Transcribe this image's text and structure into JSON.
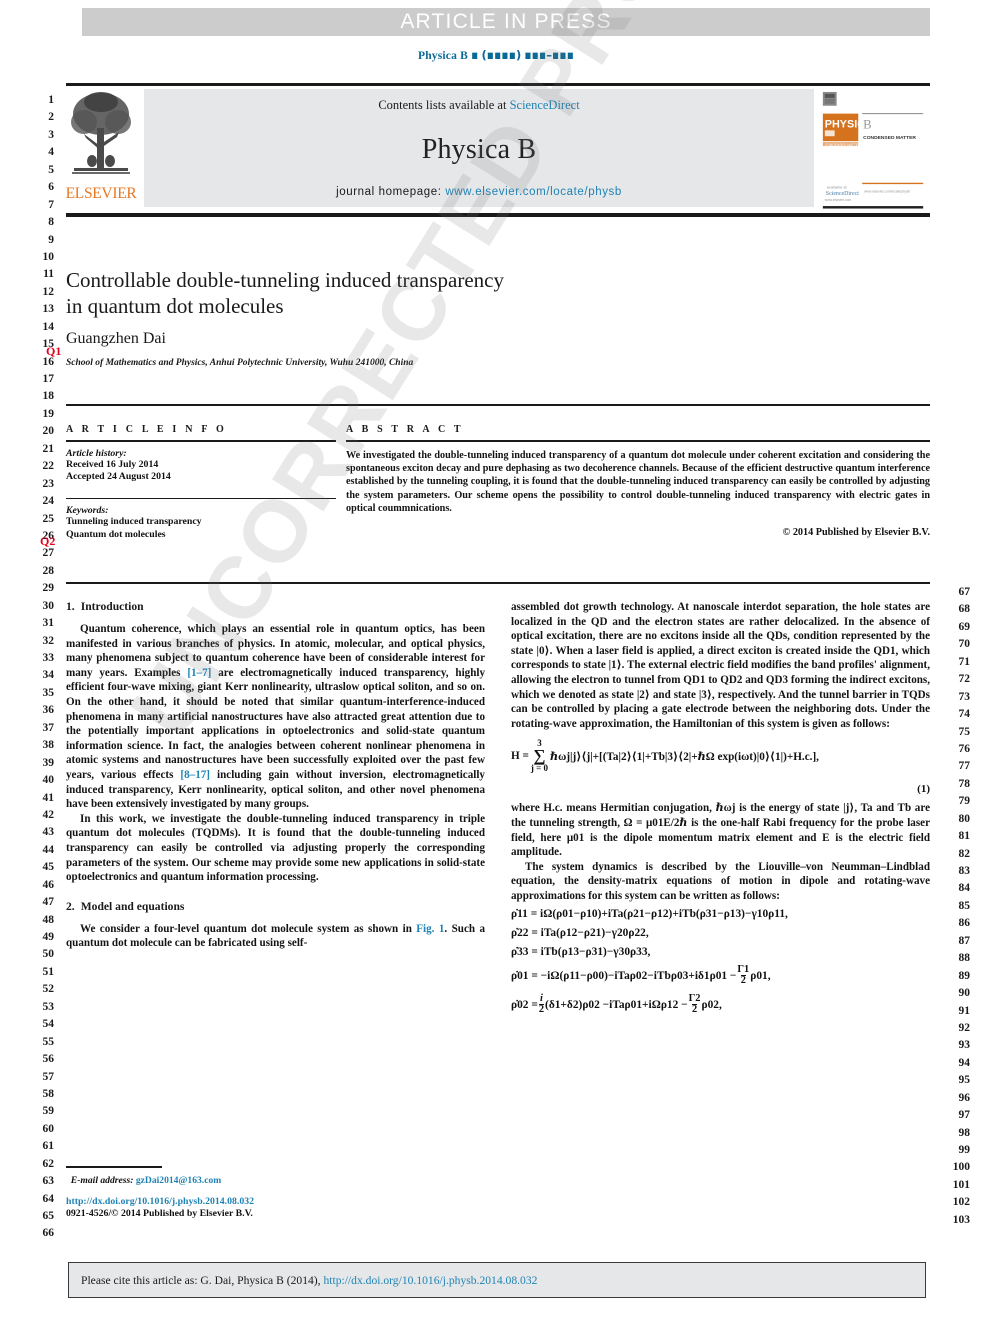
{
  "header": {
    "article_in_press": "ARTICLE IN PRESS",
    "running_ref_prefix": "Physica B",
    "running_ref_block1": "∎",
    "running_ref_paren": "(∎∎∎∎)",
    "running_ref_pages": "∎∎∎–∎∎∎"
  },
  "masthead": {
    "contents_text": "Contents lists available at",
    "sciencedirect": "ScienceDirect",
    "journal_title": "Physica B",
    "homepage_label": "journal homepage:",
    "homepage_url": "www.elsevier.com/locate/physb",
    "publisher": "ELSEVIER",
    "cover_journal": "PHYSICA",
    "cover_letter": "B",
    "cover_sub": "CONDENSED MATTER"
  },
  "title_block": {
    "title_line1": "Controllable double-tunneling induced transparency",
    "title_line2": "in quantum dot molecules",
    "author": "Guangzhen Dai",
    "affiliation": "School of Mathematics and Physics, Anhui Polytechnic University, Wuhu 241000, China",
    "query_1": "Q1",
    "query_2": "Q2"
  },
  "article_info": {
    "heading": "A R T I C L E  I N F O",
    "history_label": "Article history:",
    "received": "Received 16 July 2014",
    "accepted": "Accepted 24 August 2014",
    "keywords_label": "Keywords:",
    "keywords": [
      "Tunneling induced transparency",
      "Quantum dot molecules"
    ]
  },
  "abstract": {
    "heading": "A B S T R A C T",
    "text": "We investigated the double-tunneling induced transparency of a quantum dot molecule under coherent excitation and considering the spontaneous exciton decay and pure dephasing as two decoherence channels. Because of the efficient destructive quantum interference established by the tunneling coupling, it is found that the double-tunneling induced transparency can easily be controlled by adjusting the system parameters. Our scheme opens the possibility to control double-tunneling induced transparency with electric gates in optical coummnications.",
    "copyright": "© 2014 Published by Elsevier B.V."
  },
  "sections": {
    "s1_num": "1.",
    "s1_title": "Introduction",
    "s1_p1": "Quantum coherence, which plays an essential role in quantum optics, has been manifested in various branches of physics. In atomic, molecular, and optical physics, many phenomena subject to quantum coherence have been of considerable interest for many years. Examples [1–7] are electromagnetically induced transparency, highly efficient four-wave mixing, giant Kerr nonlinearity, ultraslow optical soliton, and so on. On the other hand, it should be noted that similar quantum-interference-induced phenomena in many artificial nanostructures have also attracted great attention due to the potentially important applications in optoelectronics and solid-state quantum information science. In fact, the analogies between coherent nonlinear phenomena in atomic systems and nanostructures have been successfully exploited over the past few years, various effects [8–17] including gain without inversion, electromagnetically induced transparency, Kerr nonlinearity, optical soliton, and other novel phenomena have been extensively investigated by many groups.",
    "s1_p1_cite1": "[1–7]",
    "s1_p1_cite2": "[8–17]",
    "s1_p2": "In this work, we investigate the double-tunneling induced transparency in triple quantum dot molecules (TQDMs). It is found that the double-tunneling induced transparency can easily be controlled via adjusting properly the corresponding parameters of the system. Our scheme may provide some new applications in solid-state optoelectronics and quantum information processing.",
    "s2_num": "2.",
    "s2_title": "Model and equations",
    "s2_p1": "We consider a four-level quantum dot molecule system as shown in Fig. 1. Such a quantum dot molecule can be fabricated using self-",
    "s2_p1_fig": "Fig. 1",
    "right_p1": "assembled dot growth technology. At nanoscale interdot separation, the hole states are localized in the QD and the electron states are rather delocalized. In the absence of optical excitation, there are no excitons inside all the QDs, condition represented by the state |0⟩. When a laser field is applied, a direct exciton is created inside the QD1, which corresponds to state |1⟩. The external electric field modifies the band profiles' alignment, allowing the electron to tunnel from QD1 to QD2 and QD3 forming the indirect excitons, which we denoted as state |2⟩ and state |3⟩, respectively. And the tunnel barrier in TQDs can be controlled by placing a gate electrode between the neighboring dots. Under the rotating-wave approximation, the Hamiltonian of this system is given as follows:",
    "right_p2": "where H.c. means Hermitian conjugation, ℏωj is the energy of state |j⟩, Ta and Tb are the tunneling strength, Ω = μ01E/2ℏ is the one-half Rabi frequency for the probe laser field, here μ01 is the dipole momentum matrix element and E is the electric field amplitude.",
    "right_p3": "The system dynamics is described by the Liouville–von Neumman–Lindblad equation, the density-matrix equations of motion in dipole and rotating-wave approximations for this system can be written as follows:"
  },
  "equations": {
    "eq1_lhs": "H =",
    "eq1_sum_top": "3",
    "eq1_sum_bot": "j = 0",
    "eq1_rhs": "ℏωj|j⟩⟨j|+[(Ta|2⟩⟨1|+Tb|3⟩⟨2|+ℏΩ exp(iωt)|0⟩⟨1|)+H.c.],",
    "eq1_number": "(1)",
    "eq2": "ρ̇11 = iΩ(ρ01−ρ10)+iTa(ρ21−ρ12)+iTb(ρ31−ρ13)−γ10ρ11,",
    "eq3": "ρ̇22 = iTa(ρ12−ρ21)−γ20ρ22,",
    "eq4": "ρ̇33 = iTb(ρ13−ρ31)−γ30ρ33,",
    "eq5_a": "ρ̇01 = −iΩ(ρ11−ρ00)−iTaρ02−iTbρ03+iδ1ρ01 −",
    "eq5_num": "Γ1",
    "eq5_den": "2",
    "eq5_b": "ρ01,",
    "eq6_a": "ρ̇02 =",
    "eq6_num1": "i",
    "eq6_den1": "2",
    "eq6_mid": "(δ1+δ2)ρ02 −iTaρ01+iΩρ12 −",
    "eq6_num2": "Γ2",
    "eq6_den2": "2",
    "eq6_b": "ρ02,"
  },
  "footnote": {
    "email_label": "E-mail address:",
    "email": "gzDai2014@163.com",
    "doi": "http://dx.doi.org/10.1016/j.physb.2014.08.032",
    "issn": "0921-4526/© 2014 Published by Elsevier B.V."
  },
  "cite_bar": {
    "prefix": "Please cite this article as: G. Dai, Physica B (2014),",
    "link": "http://dx.doi.org/10.1016/j.physb.2014.08.032"
  },
  "watermark": {
    "text": "UNCORRECTED PROOF"
  },
  "line_numbers": {
    "left_start": 1,
    "left_end": 66,
    "right_start": 67,
    "right_end": 103
  },
  "colors": {
    "link": "#1f83b5",
    "query": "#e2001a",
    "elsevier_orange": "#e87722",
    "band_gray": "#cccccc",
    "box_gray": "#e6e7e8"
  }
}
